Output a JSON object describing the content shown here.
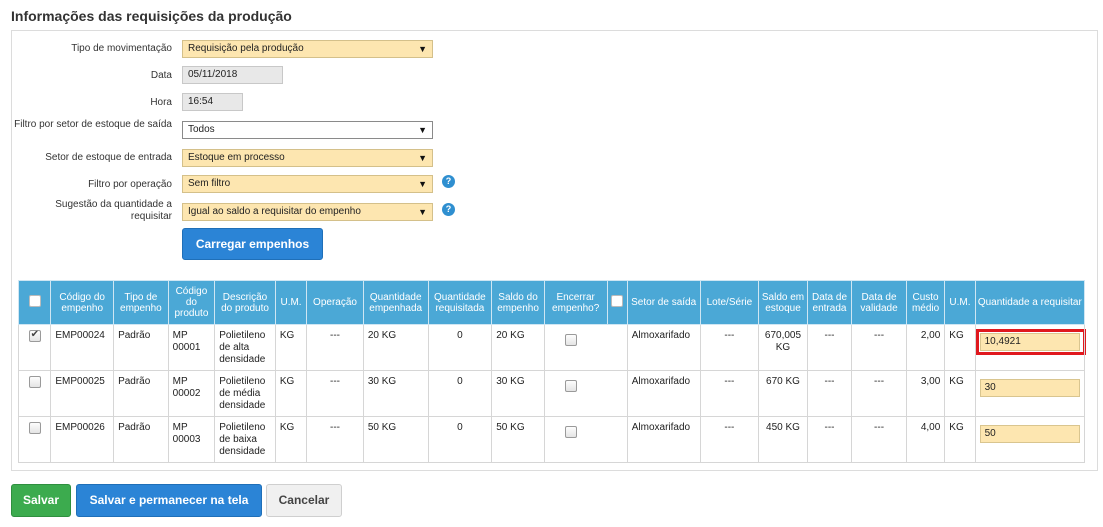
{
  "page_title": "Informações das requisições da produção",
  "form": {
    "tipo_label": "Tipo de movimentação",
    "tipo_value": "Requisição pela produção",
    "data_label": "Data",
    "data_value": "05/11/2018",
    "hora_label": "Hora",
    "hora_value": "16:54",
    "filtro_setor_label": "Filtro por setor de estoque de saída",
    "filtro_setor_value": "Todos",
    "setor_entrada_label": "Setor de estoque de entrada",
    "setor_entrada_value": "Estoque em processo",
    "filtro_operacao_label": "Filtro por operação",
    "filtro_operacao_value": "Sem filtro",
    "sugestao_label": "Sugestão da quantidade a requisitar",
    "sugestao_value": "Igual ao saldo a requisitar do empenho",
    "help_glyph": "?",
    "caret_glyph": "▼"
  },
  "load_button": "Carregar empenhos",
  "table": {
    "headers": {
      "codigo_empenho": "Código do empenho",
      "tipo_empenho": "Tipo de empenho",
      "codigo_produto": "Código do produto",
      "descricao_produto": "Descrição do produto",
      "um": "U.M.",
      "operacao": "Operação",
      "qtd_empenhada": "Quantidade empenhada",
      "qtd_requisitada": "Quantidade requisitada",
      "saldo_empenho": "Saldo do empenho",
      "encerrar_empenho": "Encerrar empenho?",
      "setor_saida": "Setor de saída",
      "lote_serie": "Lote/Série",
      "saldo_estoque": "Saldo em estoque",
      "data_entrada": "Data de entrada",
      "data_validade": "Data de validade",
      "custo_medio": "Custo médio",
      "um2": "U.M.",
      "qtd_requisitar": "Quantidade a requisitar"
    },
    "rows": [
      {
        "checked": true,
        "codigo_empenho": "EMP00024",
        "tipo_empenho": "Padrão",
        "codigo_produto": "MP 00001",
        "descricao_produto": "Polietileno de alta densidade",
        "um": "KG",
        "operacao": "---",
        "qtd_empenhada": "20 KG",
        "qtd_requisitada": "0",
        "saldo_empenho": "20 KG",
        "setor_saida": "Almoxarifado",
        "lote_serie": "---",
        "saldo_estoque": "670,005 KG",
        "data_entrada": "---",
        "data_validade": "---",
        "custo_medio": "2,00",
        "um2": "KG",
        "qtd_requisitar": "10,4921"
      },
      {
        "checked": false,
        "codigo_empenho": "EMP00025",
        "tipo_empenho": "Padrão",
        "codigo_produto": "MP 00002",
        "descricao_produto": "Polietileno de média densidade",
        "um": "KG",
        "operacao": "---",
        "qtd_empenhada": "30 KG",
        "qtd_requisitada": "0",
        "saldo_empenho": "30 KG",
        "setor_saida": "Almoxarifado",
        "lote_serie": "---",
        "saldo_estoque": "670 KG",
        "data_entrada": "---",
        "data_validade": "---",
        "custo_medio": "3,00",
        "um2": "KG",
        "qtd_requisitar": "30"
      },
      {
        "checked": false,
        "codigo_empenho": "EMP00026",
        "tipo_empenho": "Padrão",
        "codigo_produto": "MP 00003",
        "descricao_produto": "Polietileno de baixa densidade",
        "um": "KG",
        "operacao": "---",
        "qtd_empenhada": "50 KG",
        "qtd_requisitada": "0",
        "saldo_empenho": "50 KG",
        "setor_saida": "Almoxarifado",
        "lote_serie": "---",
        "saldo_estoque": "450 KG",
        "data_entrada": "---",
        "data_validade": "---",
        "custo_medio": "4,00",
        "um2": "KG",
        "qtd_requisitar": "50"
      }
    ]
  },
  "buttons": {
    "save": "Salvar",
    "save_stay": "Salvar e permanecer na tela",
    "cancel": "Cancelar"
  },
  "colors": {
    "header_blue": "#4ba8d6",
    "primary_blue": "#2b84d6",
    "success_green": "#3cab4e",
    "input_yellow": "#fde6b0",
    "highlight_red": "#e0181e"
  }
}
